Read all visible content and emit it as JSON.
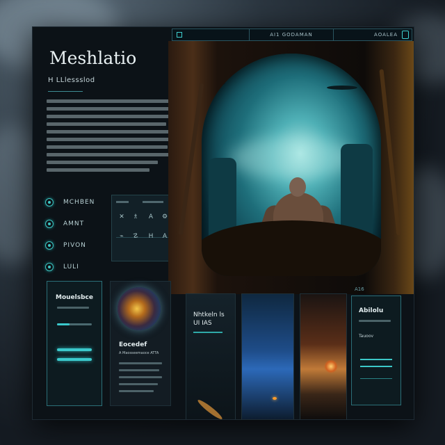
{
  "topbar": {
    "center_label": "AI1 GODAMAN",
    "right_label": "AOALEA"
  },
  "header": {
    "title": "Meshlatio",
    "subtitle": "H LLlessslod"
  },
  "nav": {
    "items": [
      {
        "label": "MCHBEN",
        "icon": "circle-icon"
      },
      {
        "label": "AMNT",
        "icon": "circle-icon"
      },
      {
        "label": "PIVON",
        "icon": "circle-icon"
      },
      {
        "label": "LULI",
        "icon": "circle-icon"
      }
    ]
  },
  "toolgrid": {
    "symbols": [
      "✕",
      "♗",
      "A",
      "⚙",
      "⌁",
      "☡",
      "H",
      "A"
    ]
  },
  "cards": {
    "card1": {
      "title": "Mouelsbce"
    },
    "card2": {
      "title": "Eocedef",
      "subtitle": "A Maosseemaoce  ATTA"
    },
    "panel1": {
      "title": "Nhtkeln ls UI IAS"
    },
    "card6": {
      "heading": "A16",
      "title": "Abilolu",
      "label": "Tauoov"
    }
  },
  "colors": {
    "accent": "#3bc9cc",
    "frame_bg": "#0c1217",
    "text": "#e2ecee"
  }
}
